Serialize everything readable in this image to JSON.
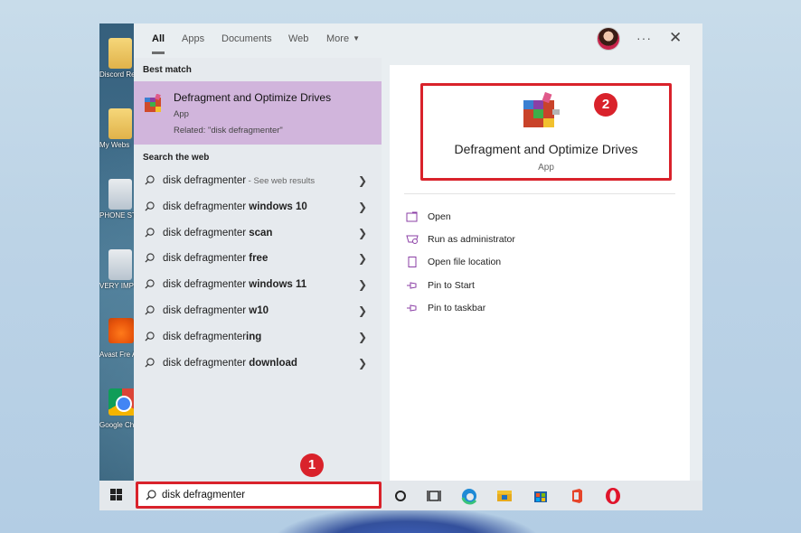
{
  "desktop": {
    "icons": [
      {
        "label": "Discord Resou",
        "kind": "folder"
      },
      {
        "label": "My Webs",
        "kind": "folder"
      },
      {
        "label": "PHONE STUF",
        "kind": "doc"
      },
      {
        "label": "VERY IMPORT",
        "kind": "doc"
      },
      {
        "label": "Avast Fre Antivir",
        "kind": "avast"
      },
      {
        "label": "Google Chrom",
        "kind": "chrome"
      }
    ]
  },
  "search": {
    "tabs": [
      {
        "label": "All",
        "active": true
      },
      {
        "label": "Apps",
        "active": false
      },
      {
        "label": "Documents",
        "active": false
      },
      {
        "label": "Web",
        "active": false
      },
      {
        "label": "More",
        "active": false
      }
    ],
    "more_icon": "···",
    "close_icon": "✕",
    "best_match_header": "Best match",
    "best_match": {
      "title": "Defragment and Optimize Drives",
      "subtitle": "App",
      "related": "Related: \"disk defragmenter\""
    },
    "web_header": "Search the web",
    "web_results": [
      {
        "pre": "disk defragmenter",
        "bold": "",
        "hint": " - See web results"
      },
      {
        "pre": "disk defragmenter ",
        "bold": "windows 10",
        "hint": ""
      },
      {
        "pre": "disk defragmenter ",
        "bold": "scan",
        "hint": ""
      },
      {
        "pre": "disk defragmenter ",
        "bold": "free",
        "hint": ""
      },
      {
        "pre": "disk defragmenter ",
        "bold": "windows 11",
        "hint": ""
      },
      {
        "pre": "disk defragmenter ",
        "bold": "w10",
        "hint": ""
      },
      {
        "pre": "disk defragmenter",
        "bold": "ing",
        "hint": ""
      },
      {
        "pre": "disk defragmenter ",
        "bold": "download",
        "hint": ""
      }
    ],
    "detail": {
      "title": "Defragment and Optimize Drives",
      "subtitle": "App",
      "actions": [
        {
          "label": "Open",
          "icon": "open-icon"
        },
        {
          "label": "Run as administrator",
          "icon": "shield-icon"
        },
        {
          "label": "Open file location",
          "icon": "file-icon"
        },
        {
          "label": "Pin to Start",
          "icon": "pin-icon"
        },
        {
          "label": "Pin to taskbar",
          "icon": "pin-icon"
        }
      ]
    },
    "query": "disk defragmenter"
  },
  "badges": {
    "one": "1",
    "two": "2"
  },
  "colors": {
    "highlight": "#d1b5dc",
    "callout": "#d9222b",
    "accent": "#8b3fa6"
  }
}
